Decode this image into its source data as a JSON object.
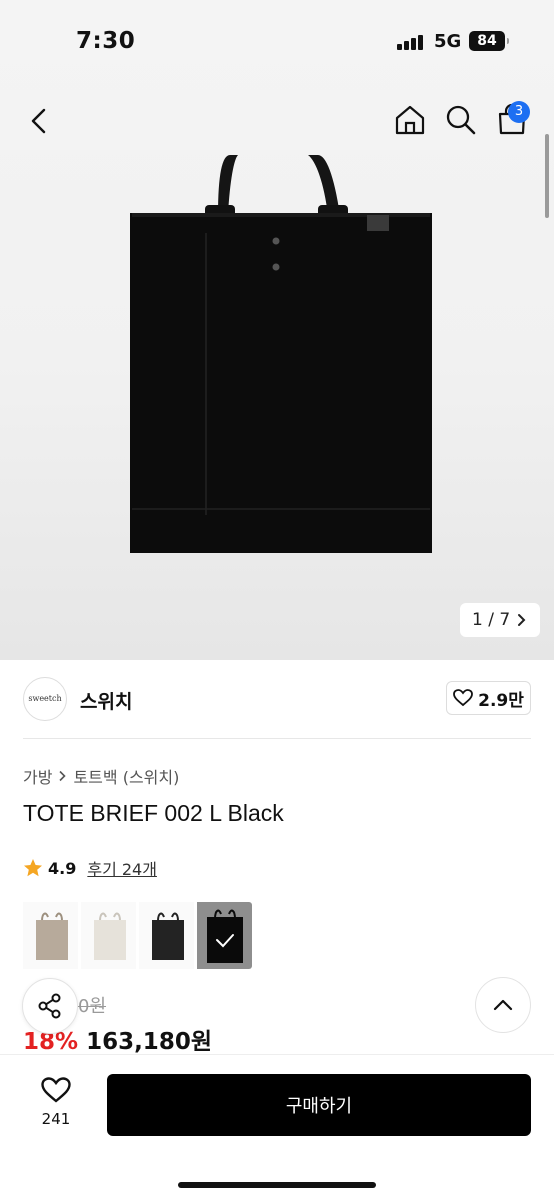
{
  "status_bar": {
    "time": "7:30",
    "network": "5G",
    "battery": "84"
  },
  "header": {
    "cart_count": "3"
  },
  "icons": [
    "back-arrow-icon",
    "home-icon",
    "search-icon",
    "cart-icon",
    "heart-icon",
    "share-icon",
    "chevron-up-icon",
    "star-icon",
    "chevron-right-icon",
    "check-icon"
  ],
  "gallery": {
    "pager": "1 / 7"
  },
  "brand": {
    "logo_text": "sweetch",
    "name": "스위치",
    "likes": "2.9만"
  },
  "breadcrumb": {
    "category": "가방",
    "subcategory": "토트백 (스위치)"
  },
  "product": {
    "title": "TOTE BRIEF 002 L Black",
    "rating": "4.9",
    "reviews": "후기 24개"
  },
  "price": {
    "original": "0원",
    "discount": "18%",
    "final": "163,180원"
  },
  "swatches": [
    {
      "color": "#b7aa9b",
      "selected": false
    },
    {
      "color": "#e6e2da",
      "selected": false
    },
    {
      "color": "#232323",
      "selected": false
    },
    {
      "color": "#0a0a0a",
      "selected": true
    }
  ],
  "bottom_bar": {
    "wish_count": "241",
    "buy_label": "구매하기"
  },
  "colors": {
    "accent_badge": "#1d6ff2",
    "discount": "#e32222",
    "star": "#f5a623"
  }
}
